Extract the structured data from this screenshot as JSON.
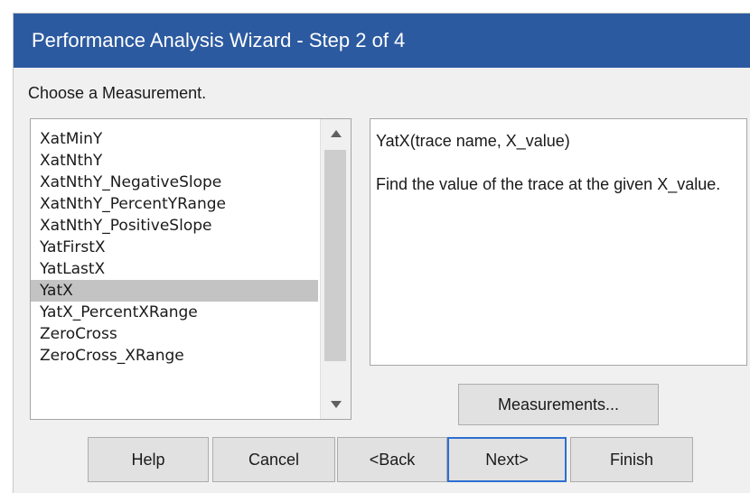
{
  "window": {
    "title": "Performance Analysis Wizard - Step 2 of 4",
    "title_bar_color": "#2c5aa0"
  },
  "prompt": "Choose a Measurement.",
  "measurements": {
    "items": [
      "XatMinY",
      "XatNthY",
      "XatNthY_NegativeSlope",
      "XatNthY_PercentYRange",
      "XatNthY_PositiveSlope",
      "YatFirstX",
      "YatLastX",
      "YatX",
      "YatX_PercentXRange",
      "ZeroCross",
      "ZeroCross_XRange"
    ],
    "selected": "YatX",
    "scroll_up_icon": "triangle-up-icon",
    "scroll_down_icon": "triangle-down-icon"
  },
  "description": {
    "signature": "YatX(trace name, X_value)",
    "text": "Find the value of the trace at the given X_value."
  },
  "buttons": {
    "measurements": "Measurements...",
    "help": "Help",
    "cancel": "Cancel",
    "back": "<Back",
    "next": "Next>",
    "finish": "Finish"
  }
}
